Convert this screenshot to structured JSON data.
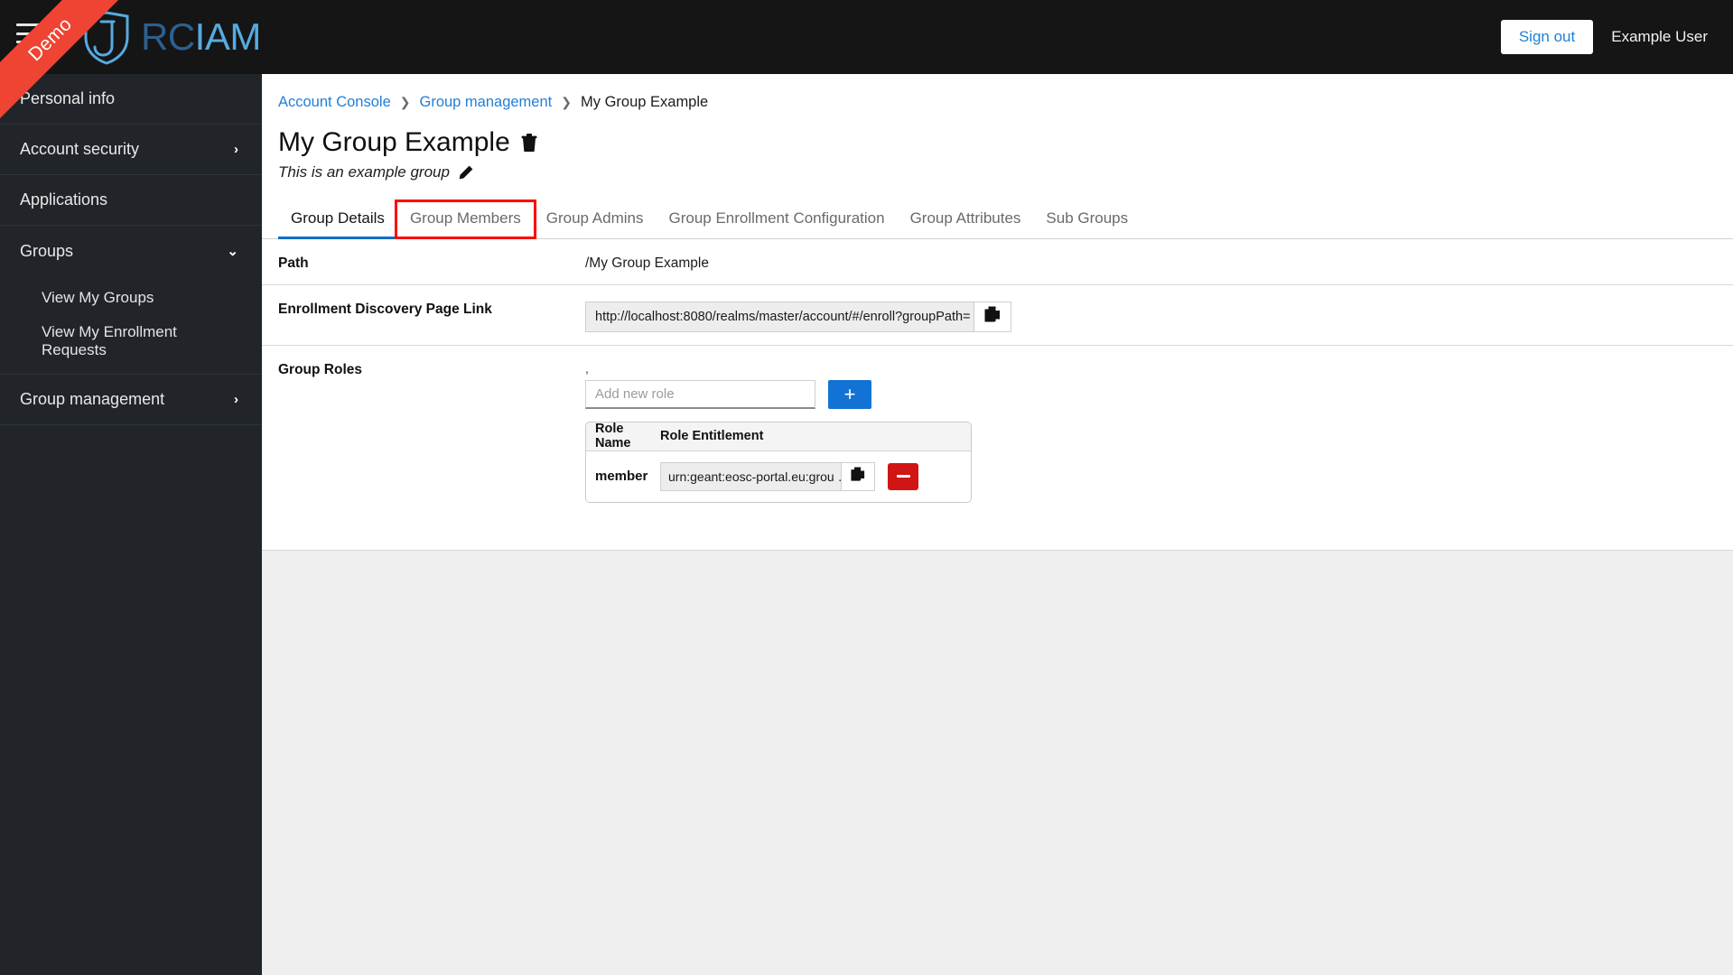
{
  "brand": {
    "wordmark_rc": "RC",
    "wordmark_iam": "IAM",
    "shield_icon": "shield-icon",
    "hamburger_icon": "hamburger-menu-icon"
  },
  "ribbon": {
    "text": "Demo",
    "color": "#ef4433"
  },
  "header": {
    "signout_label": "Sign out",
    "username": "Example User",
    "accent_color": "#1f7fd6",
    "background_color": "#151515"
  },
  "sidebar": {
    "background_color": "#212529",
    "items": [
      {
        "label": "Personal info",
        "chevron": "",
        "sub": false
      },
      {
        "label": "Account security",
        "chevron": "›",
        "sub": false
      },
      {
        "label": "Applications",
        "chevron": "",
        "sub": false
      },
      {
        "label": "Groups",
        "chevron": "⌄",
        "sub": false
      },
      {
        "label": "View My Groups",
        "chevron": "",
        "sub": true
      },
      {
        "label": "View My Enrollment Requests",
        "chevron": "",
        "sub": true
      },
      {
        "label": "Group management",
        "chevron": "›",
        "sub": false
      }
    ]
  },
  "breadcrumb": {
    "items": [
      {
        "label": "Account Console",
        "link": true
      },
      {
        "label": "Group management",
        "link": true
      },
      {
        "label": "My Group Example",
        "link": false
      }
    ],
    "separator": "❯"
  },
  "page": {
    "title": "My Group Example",
    "subtitle": "This is an example group",
    "delete_icon": "trash-icon",
    "edit_icon": "pencil-icon"
  },
  "tabs": [
    {
      "label": "Group Details",
      "active": true,
      "highlighted": false
    },
    {
      "label": "Group Members",
      "active": false,
      "highlighted": true
    },
    {
      "label": "Group Admins",
      "active": false,
      "highlighted": false
    },
    {
      "label": "Group Enrollment Configuration",
      "active": false,
      "highlighted": false
    },
    {
      "label": "Group Attributes",
      "active": false,
      "highlighted": false
    },
    {
      "label": "Sub Groups",
      "active": false,
      "highlighted": false
    }
  ],
  "highlight_color": "#ff0000",
  "details": {
    "path_label": "Path",
    "path_value": "/My Group Example",
    "enrollment_label": "Enrollment Discovery Page Link",
    "enrollment_value": "http://localhost:8080/realms/master/account/#/enroll?groupPath= …",
    "copy_icon": "copy-icon",
    "roles_label": "Group Roles"
  },
  "roles": {
    "separator_mark": ",",
    "add_placeholder": "Add new role",
    "add_value": "",
    "add_button_label": "+",
    "columns": [
      "Role Name",
      "Role Entitlement"
    ],
    "rows": [
      {
        "name": "member",
        "entitlement": "urn:geant:eosc-portal.eu:grou …",
        "copy_icon": "copy-icon",
        "remove_icon": "minus-icon"
      }
    ]
  }
}
